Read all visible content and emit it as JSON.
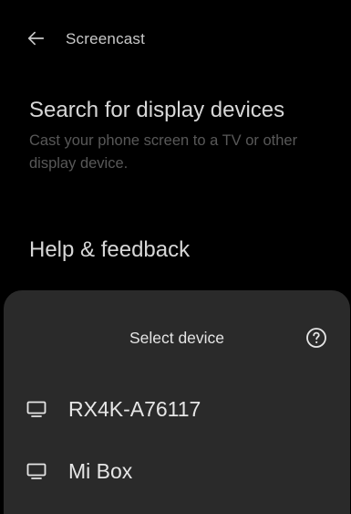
{
  "appbar": {
    "title": "Screencast",
    "back_icon": "arrow-left-icon"
  },
  "settings": [
    {
      "title": "Search for display devices",
      "subtitle": "Cast your phone screen to a TV or other display device."
    },
    {
      "title": "Help & feedback"
    }
  ],
  "sheet": {
    "title": "Select device",
    "help_icon": "help-circle-icon",
    "devices": [
      {
        "label": "RX4K-A76117",
        "icon": "monitor-icon"
      },
      {
        "label": "Mi Box",
        "icon": "monitor-icon"
      }
    ]
  },
  "colors": {
    "background": "#000000",
    "sheet_background": "#2a2a2a",
    "primary_text": "#e6e6e6",
    "secondary_text": "#585858"
  }
}
